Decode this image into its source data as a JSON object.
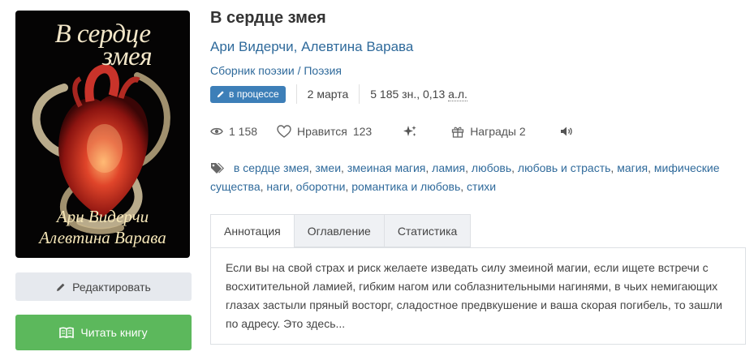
{
  "cover": {
    "title_line1": "В сердце",
    "title_line2": "змея",
    "author_line1": "Ари Видерчи",
    "author_line2": "Алевтина Варава"
  },
  "buttons": {
    "edit_label": "Редактировать",
    "read_label": "Читать книгу"
  },
  "book": {
    "title": "В сердце змея",
    "authors": [
      "Ари Видерчи",
      "Алевтина Варава"
    ],
    "author_separator": ", ",
    "genres": "Сборник поэзии / Поэзия",
    "status_badge": "в процессе",
    "date": "2 марта",
    "size_chars": "5 185 зн., 0,13",
    "size_unit": "а.л."
  },
  "stats": {
    "views": "1 158",
    "likes_label": "Нравится",
    "likes_count": "123",
    "awards_label": "Награды 2"
  },
  "tags": [
    "в сердце змея",
    "змеи",
    "змеиная магия",
    "ламия",
    "любовь",
    "любовь и страсть",
    "магия",
    "мифические существа",
    "наги",
    "оборотни",
    "романтика и любовь",
    "стихи"
  ],
  "tabs": [
    {
      "label": "Аннотация",
      "active": true
    },
    {
      "label": "Оглавление",
      "active": false
    },
    {
      "label": "Статистика",
      "active": false
    }
  ],
  "annotation": "Если вы на свой страх и риск желаете изведать силу змеиной магии, если ищете встречи с восхитительной ламией, гибким нагом или соблазнительными нагинями, в чьих немигающих глазах застыли пряный восторг, сладостное предвкушение и ваша скорая погибель, то зашли по адресу. Это здесь...",
  "colors": {
    "link": "#2f6a9b",
    "badge": "#3d7fb8",
    "read_button": "#5cb85c",
    "edit_button": "#e6e9ee"
  }
}
